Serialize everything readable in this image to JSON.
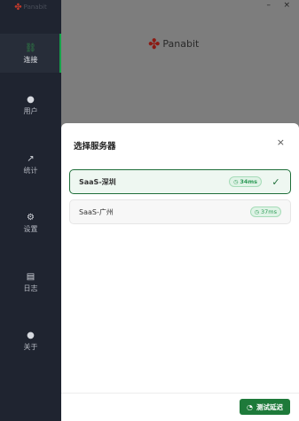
{
  "app": {
    "brand": "Panabit"
  },
  "window": {
    "minimize": "–",
    "close": "×"
  },
  "sidebar": {
    "items": [
      {
        "label": "连接",
        "icon": "link-icon",
        "glyph": "🔗"
      },
      {
        "label": "用户",
        "icon": "user-icon",
        "glyph": "👤"
      },
      {
        "label": "统计",
        "icon": "trend-icon",
        "glyph": "↗"
      },
      {
        "label": "设置",
        "icon": "gear-icon",
        "glyph": "⚙"
      },
      {
        "label": "日志",
        "icon": "document-icon",
        "glyph": "🗎"
      },
      {
        "label": "关于",
        "icon": "info-icon",
        "glyph": "ℹ"
      }
    ]
  },
  "dialog": {
    "title": "选择服务器",
    "close": "×",
    "servers": [
      {
        "name": "SaaS-深圳",
        "latency": "34ms",
        "selected": true
      },
      {
        "name": "SaaS-广州",
        "latency": "37ms",
        "selected": false
      }
    ],
    "test_button": "测试延迟",
    "check": "✓"
  },
  "colors": {
    "accent": "#1e7a3a",
    "sidebar": "#1f2430"
  }
}
